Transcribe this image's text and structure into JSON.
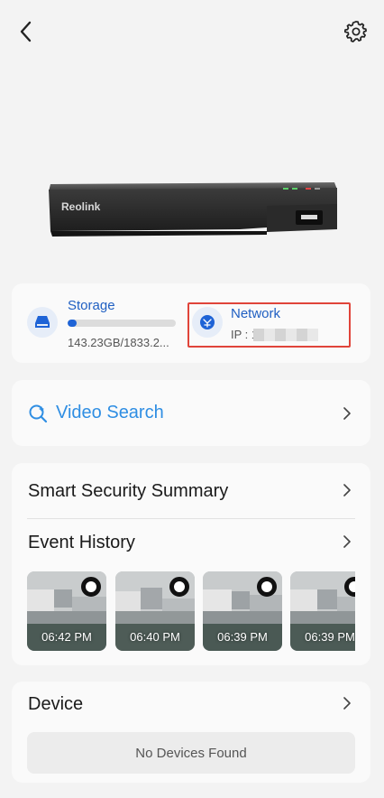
{
  "icons": {
    "back": "chevron-left-icon",
    "settings": "gear-icon",
    "storage": "hard-drive-icon",
    "network": "network-icon",
    "video_search": "search-icon",
    "chevron": "chevron-right-icon"
  },
  "device_image": {
    "brand": "Reolink"
  },
  "storage": {
    "title": "Storage",
    "usage_text": "143.23GB/1833.2...",
    "used_fraction": 0.08
  },
  "network": {
    "title": "Network",
    "ip_label": "IP : 19"
  },
  "video_search": {
    "label": "Video Search"
  },
  "smart_summary": {
    "label": "Smart Security Summary"
  },
  "event_history": {
    "label": "Event History",
    "thumbnails": [
      {
        "time": "06:42 PM"
      },
      {
        "time": "06:40 PM"
      },
      {
        "time": "06:39 PM"
      },
      {
        "time": "06:39 PM"
      }
    ]
  },
  "device_section": {
    "label": "Device",
    "empty_text": "No Devices Found"
  },
  "colors": {
    "accent_blue": "#1f5fc2",
    "search_blue": "#2f8ee3",
    "highlight_red": "#e0443a",
    "background": "#f3f3f3"
  }
}
